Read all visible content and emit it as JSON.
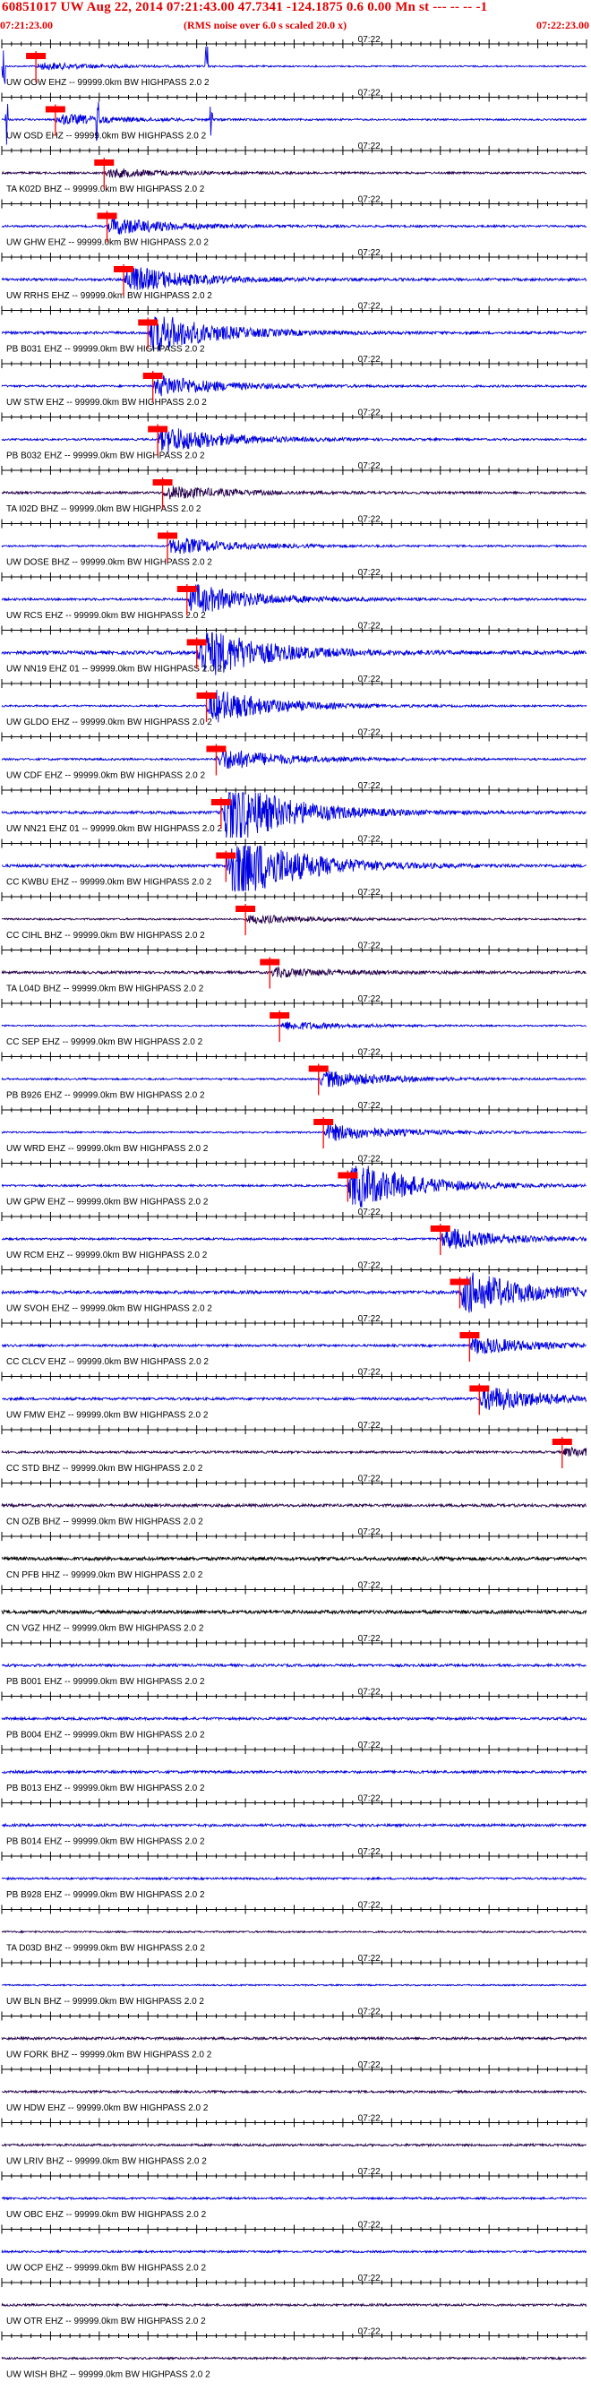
{
  "header": {
    "title": "60851017 UW Aug 22, 2014 07:21:43.00   47.7341 -124.1875  0.6 0.00 Mn st --- -- --  -1",
    "start_time": "07:21:23.00",
    "end_time": "07:22:23.00",
    "rms_note": "(RMS noise over 6.0 s scaled 20.0 x)"
  },
  "colors": {
    "trace_blue": "#0000e0",
    "trace_dark": "#24004a",
    "trace_black": "#000000",
    "pick_red": "#ff0000",
    "label_gray": "#000000"
  },
  "chart_data": {
    "type": "line",
    "title": "60851017 UW Aug 22, 2014 07:21:43.00   47.7341 -124.1875  0.6 0.00 Mn st --- -- --  -1",
    "xlabel": "",
    "ylabel": "",
    "x_start": "07:21:23.00",
    "x_end": "07:22:23.00",
    "xlim": [
      0,
      60
    ],
    "minute_label": "07:22",
    "minute_mark_sec": 37,
    "filter_suffix": " -- 99999.0km BW  HIGHPASS  2.0  2",
    "grid": false,
    "series": [
      {
        "name": "UW OOW EHZ",
        "color": "blue",
        "pick_sec": 3.5,
        "amp": 0.25,
        "burst": 0.8,
        "spikes": [
          0.2,
          21.0
        ]
      },
      {
        "name": "UW OSD EHZ",
        "color": "blue",
        "pick_sec": 5.5,
        "amp": 0.3,
        "burst": 1.2,
        "spikes": [
          0.5,
          9.8,
          21.5
        ]
      },
      {
        "name": "TA K02D BHZ",
        "color": "dark",
        "pick_sec": 10.5,
        "amp": 0.35,
        "burst": 1.0
      },
      {
        "name": "UW GHW EHZ",
        "color": "blue",
        "pick_sec": 10.8,
        "amp": 0.35,
        "burst": 2.0
      },
      {
        "name": "UW RRHS EHZ",
        "color": "blue",
        "pick_sec": 12.5,
        "amp": 0.45,
        "burst": 3.0
      },
      {
        "name": "PB B031 EHZ",
        "color": "blue",
        "pick_sec": 15.0,
        "amp": 0.45,
        "burst": 4.5
      },
      {
        "name": "UW STW EHZ",
        "color": "blue",
        "pick_sec": 15.5,
        "amp": 0.35,
        "burst": 2.5
      },
      {
        "name": "PB B032 EHZ",
        "color": "blue",
        "pick_sec": 16.0,
        "amp": 0.35,
        "burst": 3.2
      },
      {
        "name": "TA I02D BHZ",
        "color": "dark",
        "pick_sec": 16.5,
        "amp": 0.4,
        "burst": 1.5
      },
      {
        "name": "UW DOSE BHZ",
        "color": "blue",
        "pick_sec": 17.0,
        "amp": 0.3,
        "burst": 2.0
      },
      {
        "name": "UW RCS EHZ",
        "color": "blue",
        "pick_sec": 19.0,
        "amp": 0.4,
        "burst": 3.5
      },
      {
        "name": "UW NN19 EHZ 01",
        "color": "blue",
        "pick_sec": 20.0,
        "amp": 0.6,
        "burst": 6.0
      },
      {
        "name": "UW GLDO EHZ",
        "color": "blue",
        "pick_sec": 21.0,
        "amp": 0.3,
        "burst": 4.0
      },
      {
        "name": "UW CDF EHZ",
        "color": "blue",
        "pick_sec": 22.0,
        "amp": 0.35,
        "burst": 2.5
      },
      {
        "name": "UW NN21 EHZ 01",
        "color": "blue",
        "pick_sec": 22.5,
        "amp": 0.5,
        "burst": 8.0
      },
      {
        "name": "CC KWBU EHZ",
        "color": "blue",
        "pick_sec": 23.0,
        "amp": 0.5,
        "burst": 9.0
      },
      {
        "name": "CC CIHL BHZ",
        "color": "dark",
        "pick_sec": 25.0,
        "amp": 0.3,
        "burst": 1.0
      },
      {
        "name": "TA L04D BHZ",
        "color": "dark",
        "pick_sec": 27.5,
        "amp": 0.45,
        "burst": 1.0
      },
      {
        "name": "CC SEP EHZ",
        "color": "blue",
        "pick_sec": 28.5,
        "amp": 0.25,
        "burst": 1.0
      },
      {
        "name": "PB B926 EHZ",
        "color": "blue",
        "pick_sec": 32.5,
        "amp": 0.3,
        "burst": 2.0
      },
      {
        "name": "UW WRD EHZ",
        "color": "blue",
        "pick_sec": 33.0,
        "amp": 0.3,
        "burst": 2.0
      },
      {
        "name": "UW GPW EHZ",
        "color": "blue",
        "pick_sec": 35.5,
        "amp": 0.35,
        "burst": 5.5
      },
      {
        "name": "UW RCM EHZ",
        "color": "blue",
        "pick_sec": 45.0,
        "amp": 0.35,
        "burst": 2.5
      },
      {
        "name": "UW SVOH EHZ",
        "color": "blue",
        "pick_sec": 47.0,
        "amp": 0.55,
        "burst": 5.0
      },
      {
        "name": "CC CLCV EHZ",
        "color": "blue",
        "pick_sec": 48.0,
        "amp": 0.4,
        "burst": 2.0
      },
      {
        "name": "UW FMW EHZ",
        "color": "blue",
        "pick_sec": 49.0,
        "amp": 0.45,
        "burst": 3.0
      },
      {
        "name": "CC STD BHZ",
        "color": "dark",
        "pick_sec": 57.5,
        "amp": 0.4,
        "burst": 1.0
      },
      {
        "name": "CN OZB BHZ",
        "color": "dark",
        "amp": 0.5
      },
      {
        "name": "CN PFB HHZ",
        "color": "black",
        "amp": 0.6
      },
      {
        "name": "CN VGZ HHZ",
        "color": "black",
        "amp": 0.6
      },
      {
        "name": "PB B001 EHZ",
        "color": "blue",
        "amp": 0.45
      },
      {
        "name": "PB B004 EHZ",
        "color": "blue",
        "amp": 0.45
      },
      {
        "name": "PB B013 EHZ",
        "color": "blue",
        "amp": 0.45
      },
      {
        "name": "PB B014 EHZ",
        "color": "blue",
        "amp": 0.45
      },
      {
        "name": "PB B928 EHZ",
        "color": "blue",
        "amp": 0.35
      },
      {
        "name": "TA D03D BHZ",
        "color": "dark",
        "amp": 0.3
      },
      {
        "name": "UW BLN BHZ",
        "color": "blue",
        "amp": 0.25
      },
      {
        "name": "UW FORK BHZ",
        "color": "dark",
        "amp": 0.45
      },
      {
        "name": "UW HDW EHZ",
        "color": "dark",
        "amp": 0.4
      },
      {
        "name": "UW LRIV BHZ",
        "color": "dark",
        "amp": 0.4
      },
      {
        "name": "UW OBC EHZ",
        "color": "blue",
        "amp": 0.35
      },
      {
        "name": "UW OCP EHZ",
        "color": "blue",
        "amp": 0.35
      },
      {
        "name": "UW OTR EHZ",
        "color": "dark",
        "amp": 0.4
      },
      {
        "name": "UW WISH BHZ",
        "color": "dark",
        "amp": 0.35
      }
    ]
  }
}
